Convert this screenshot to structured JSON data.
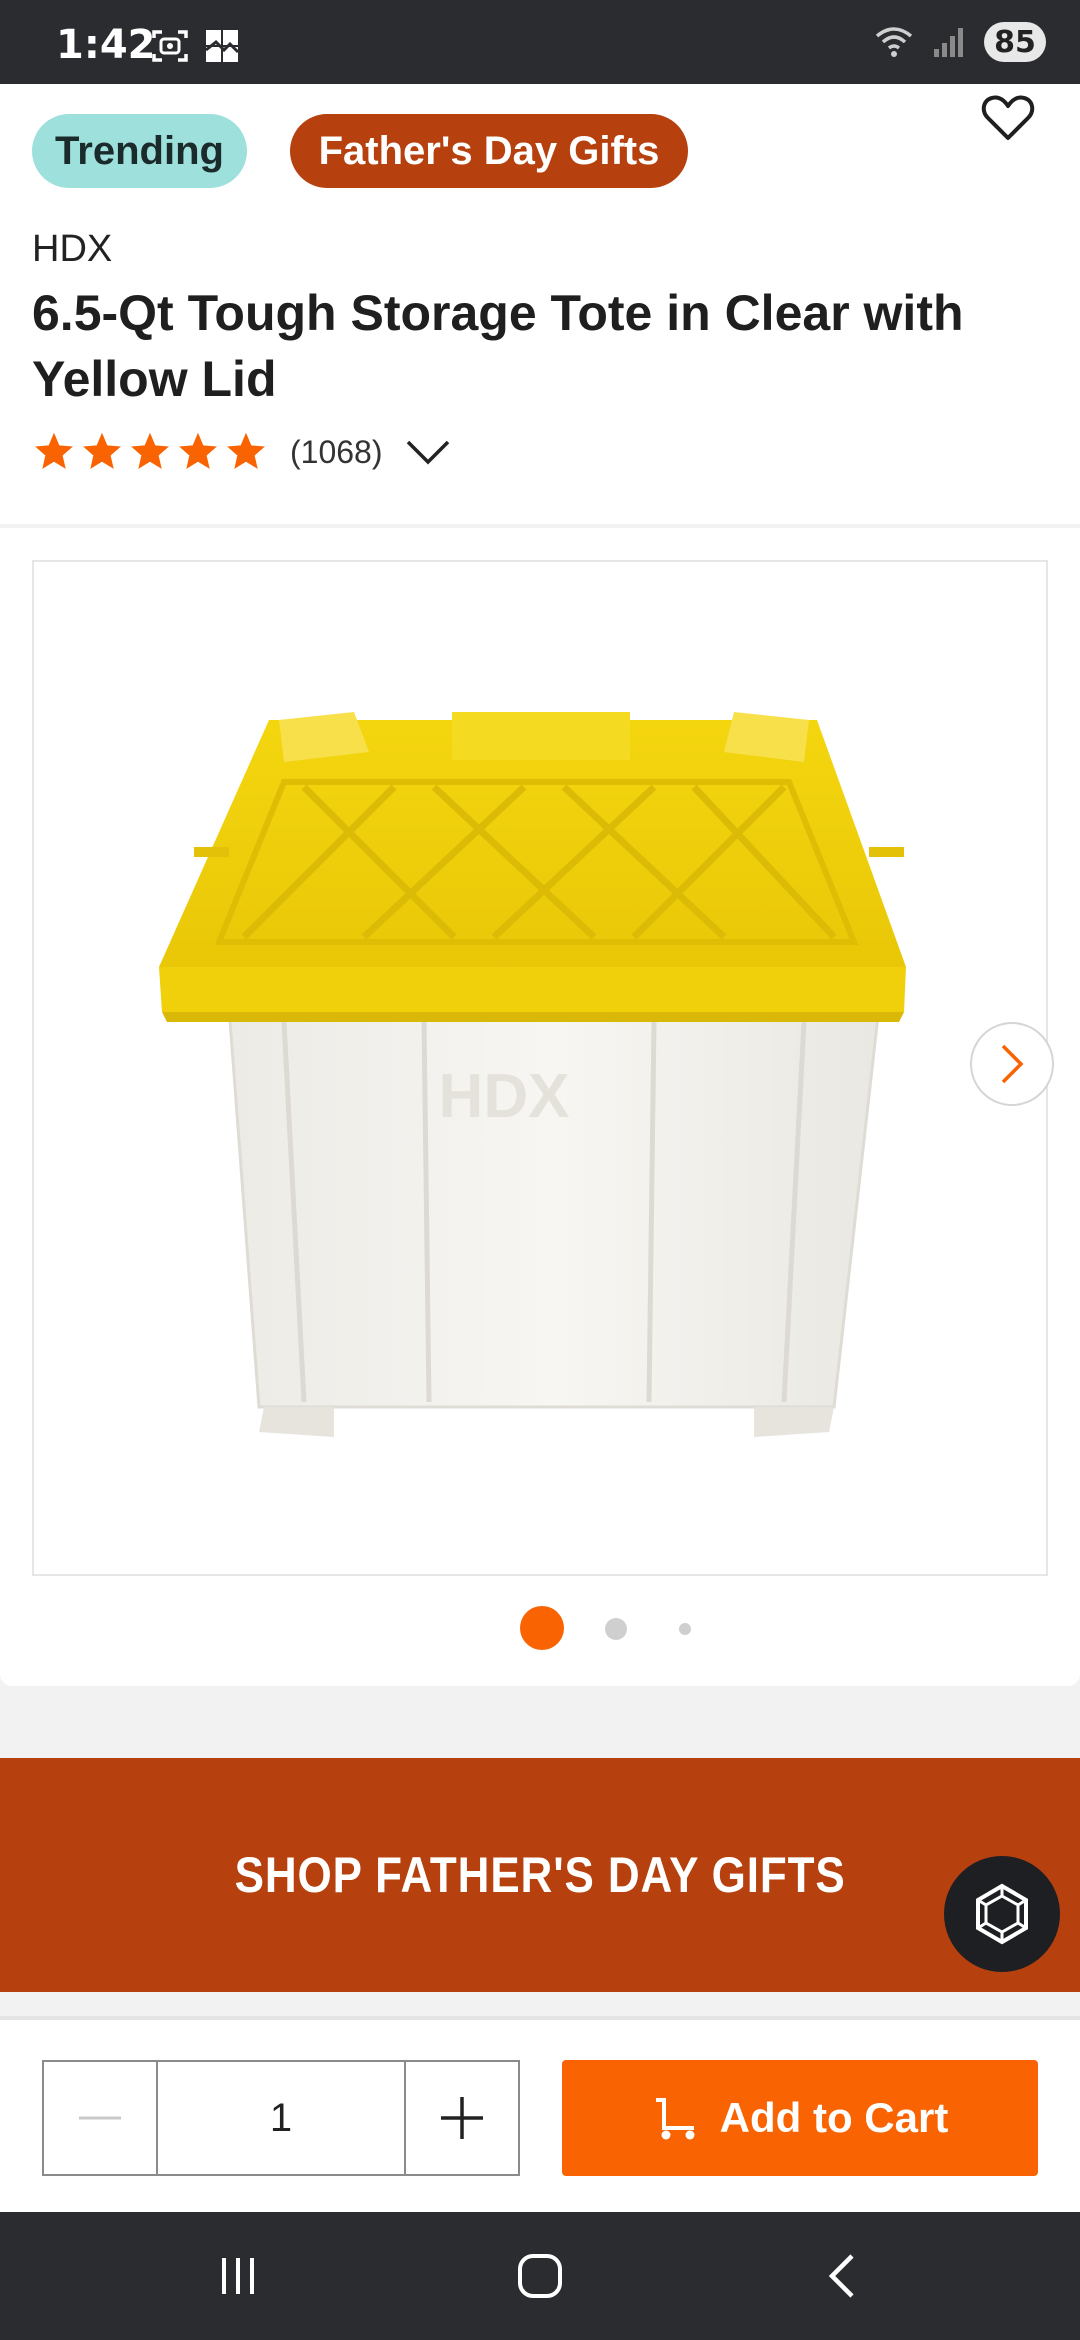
{
  "status_bar": {
    "time": "1:42",
    "battery": "85",
    "icons": [
      "screenshot-icon",
      "gallery-icon",
      "wifi-icon",
      "signal-icon"
    ]
  },
  "chips": {
    "trending": "Trending",
    "fathers_day": "Father's Day Gifts"
  },
  "product": {
    "brand": "HDX",
    "title": "6.5-Qt Tough Storage Tote in Clear with Yellow Lid",
    "rating": 5,
    "review_count": "(1068)"
  },
  "gallery": {
    "image_count": 3,
    "active_index": 0,
    "image_embossed_text": "HDX"
  },
  "promo": {
    "text": "SHOP FATHER'S DAY GIFTS"
  },
  "cart": {
    "quantity": "1",
    "add_label": "Add to Cart"
  },
  "colors": {
    "accent_orange": "#f96302",
    "brand_rust": "#b6400e",
    "trending_teal": "#9ee0db",
    "lid_yellow": "#f2d10c",
    "system_bar": "#2b2c30"
  }
}
